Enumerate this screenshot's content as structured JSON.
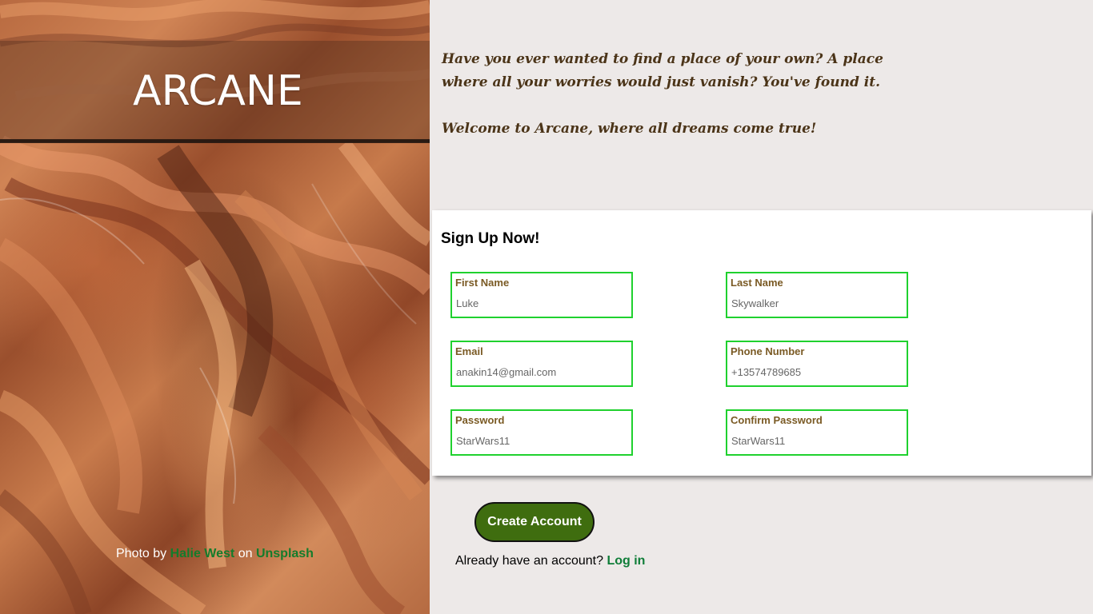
{
  "brand": {
    "title": "ARCANE"
  },
  "photo_credit": {
    "prefix": "Photo by",
    "author": "Halie West",
    "middle": "on",
    "source": "Unsplash"
  },
  "intro": {
    "paragraph1": "Have you ever wanted to find a place of your own? A place where all your worries would just vanish? You've found it.",
    "paragraph2": "Welcome to Arcane, where all dreams come true!"
  },
  "signup": {
    "title": "Sign Up Now!",
    "fields": {
      "first_name": {
        "label": "First Name",
        "placeholder": "Luke"
      },
      "last_name": {
        "label": "Last Name",
        "placeholder": "Skywalker"
      },
      "email": {
        "label": "Email",
        "placeholder": "anakin14@gmail.com"
      },
      "phone": {
        "label": "Phone Number",
        "placeholder": "+13574789685"
      },
      "password": {
        "label": "Password",
        "placeholder": "StarWars11"
      },
      "confirm_password": {
        "label": "Confirm Password",
        "placeholder": "StarWars11"
      }
    },
    "submit_label": "Create Account"
  },
  "login_prompt": {
    "text": "Already have an account?",
    "link": "Log in"
  },
  "colors": {
    "background": "#ede9e8",
    "accent_green": "#1fd12e",
    "button_green": "#3f6d0f",
    "link_green": "#0f7d38",
    "label_brown": "#7a5a24"
  },
  "icons": []
}
